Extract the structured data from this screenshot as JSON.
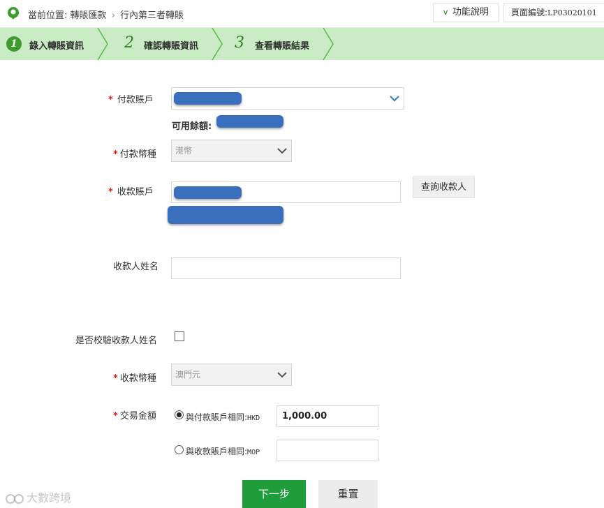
{
  "header": {
    "location_label": "當前位置:",
    "breadcrumb": [
      "轉賬匯款",
      "行內第三者轉賬"
    ],
    "breadcrumb_separator": "›",
    "help_label": "功能說明",
    "page_code_label": "頁面編號:",
    "page_code_value": "LP03020101"
  },
  "steps": [
    {
      "number": "1",
      "label": "錄入轉賬資訊",
      "active": true
    },
    {
      "number": "2",
      "label": "確認轉賬資訊",
      "active": false
    },
    {
      "number": "3",
      "label": "查看轉賬結果",
      "active": false
    }
  ],
  "form": {
    "pay_account": {
      "label": "付款賬戶",
      "required": true
    },
    "balance": {
      "label": "可用餘額:"
    },
    "pay_currency": {
      "label": "付款幣種",
      "required": true,
      "value": "港幣"
    },
    "recv_account": {
      "label": "收款賬戶",
      "required": true,
      "lookup_button": "查詢收款人"
    },
    "payee_name": {
      "label": "收款人姓名",
      "value": ""
    },
    "verify_name": {
      "label": "是否校驗收款人姓名",
      "checked": false
    },
    "recv_currency": {
      "label": "收款幣種",
      "required": true,
      "value": "澳門元"
    },
    "amount": {
      "label": "交易金額",
      "required": true,
      "options": [
        {
          "label": "與付款賬戶相同:",
          "currency": "HKD",
          "value": "1,000.00",
          "checked": true
        },
        {
          "label": "與收款賬戶相同:",
          "currency": "MOP",
          "value": "",
          "checked": false
        }
      ]
    }
  },
  "buttons": {
    "next": "下一步",
    "reset": "重置"
  },
  "watermark": "大數跨境",
  "required_mark": "*",
  "colors": {
    "brand_green": "#1f9d3a",
    "step_bar": "#c9ecc4",
    "required": "#d9211c",
    "redaction": "#3a6fbd"
  }
}
